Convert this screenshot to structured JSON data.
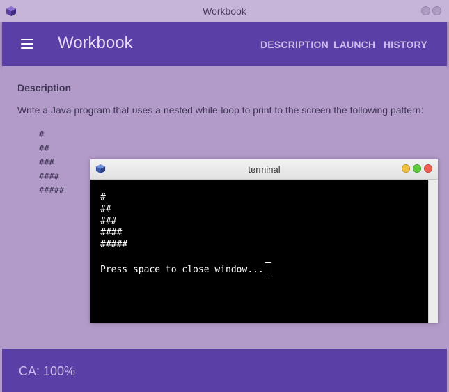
{
  "window": {
    "title": "Workbook",
    "icon": "cube-icon"
  },
  "appbar": {
    "title": "Workbook",
    "nav": [
      "DESCRIPTION",
      "LAUNCH",
      "HISTORY"
    ]
  },
  "content": {
    "heading": "Description",
    "text": "Write a Java program that uses a nested while-loop to print to the screen the following pattern:",
    "pattern": [
      "#",
      "##",
      "###",
      "####",
      "#####"
    ]
  },
  "footer": {
    "ca": "CA: 100%"
  },
  "terminal": {
    "title": "terminal",
    "output": [
      "#",
      "##",
      "###",
      "####",
      "#####",
      "",
      "Press space to close window..."
    ],
    "colors": {
      "minimize": "#f2c03f",
      "maximize": "#5ccb3a",
      "close": "#f25f54"
    }
  }
}
